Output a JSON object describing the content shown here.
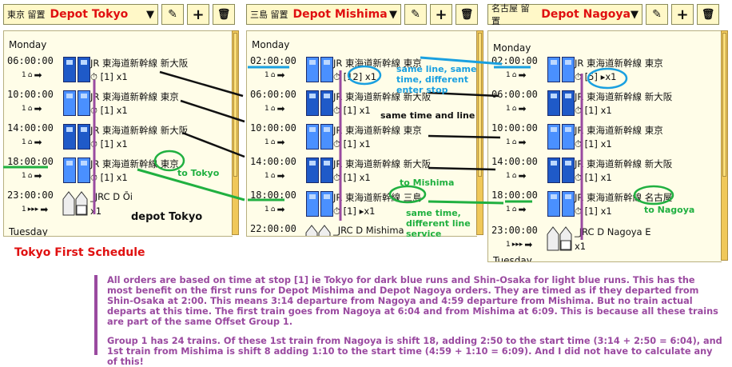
{
  "panels": [
    {
      "prefix": "東京 留置",
      "depot": "Depot Tokyo",
      "day": "Monday",
      "next_day": "Tuesday",
      "rows": [
        {
          "time": "06:00:00",
          "count": "1",
          "line": "JR 東海道新幹線 新大阪",
          "stop": "[1] x1",
          "kind": "dark"
        },
        {
          "time": "10:00:00",
          "count": "1",
          "line": "JR 東海道新幹線 東京",
          "stop": "[1] x1",
          "kind": "light"
        },
        {
          "time": "14:00:00",
          "count": "1",
          "line": "JR 東海道新幹線 新大阪",
          "stop": "[1] x1",
          "kind": "dark"
        },
        {
          "time": "18:00:00",
          "count": "1",
          "line": "JR 東海道新幹線 東京",
          "stop": "[1] x1",
          "kind": "light"
        },
        {
          "time": "23:00:00",
          "count": "1",
          "line": "_JRC D Ōi",
          "stop": "x1",
          "kind": "depot"
        }
      ]
    },
    {
      "prefix": "三島 留置",
      "depot": "Depot Mishima",
      "day": "Monday",
      "rows": [
        {
          "time": "02:00:00",
          "count": "1",
          "line": "JR 東海道新幹線 東京",
          "stop": "[12] x1",
          "kind": "light"
        },
        {
          "time": "06:00:00",
          "count": "1",
          "line": "JR 東海道新幹線 新大阪",
          "stop": "[1] x1",
          "kind": "dark"
        },
        {
          "time": "10:00:00",
          "count": "1",
          "line": "JR 東海道新幹線 東京",
          "stop": "[1] x1",
          "kind": "light"
        },
        {
          "time": "14:00:00",
          "count": "1",
          "line": "JR 東海道新幹線 新大阪",
          "stop": "[1] x1",
          "kind": "dark"
        },
        {
          "time": "18:00:00",
          "count": "1",
          "line": "JR 東海道新幹線 三島",
          "stop": "[1] ▸x1",
          "kind": "light"
        },
        {
          "time": "22:00:00",
          "count": "1",
          "line": "_JRC D Mishima",
          "stop": "x1",
          "kind": "depot"
        }
      ]
    },
    {
      "prefix": "名古屋 留置",
      "depot": "Depot Nagoya",
      "day": "Monday",
      "next_day": "Tuesday",
      "rows": [
        {
          "time": "02:00:00",
          "count": "1",
          "line": "JR 東海道新幹線 東京",
          "stop": "[5] ▸x1",
          "kind": "light"
        },
        {
          "time": "06:00:00",
          "count": "1",
          "line": "JR 東海道新幹線 新大阪",
          "stop": "[1] x1",
          "kind": "dark"
        },
        {
          "time": "10:00:00",
          "count": "1",
          "line": "JR 東海道新幹線 東京",
          "stop": "[1] x1",
          "kind": "light"
        },
        {
          "time": "14:00:00",
          "count": "1",
          "line": "JR 東海道新幹線 新大阪",
          "stop": "[1] x1",
          "kind": "dark"
        },
        {
          "time": "18:00:00",
          "count": "1",
          "line": "JR 東海道新幹線 名古屋",
          "stop": "[1] x1",
          "kind": "light"
        },
        {
          "time": "23:00:00",
          "count": "1",
          "line": "_JRC D Nagoya E",
          "stop": "x1",
          "kind": "depot"
        }
      ]
    }
  ],
  "buttons": {
    "edit": "✎",
    "add": "+",
    "delete": "🗑"
  },
  "annotations": {
    "to_tokyo": "to Tokyo",
    "depot_tokyo": "depot Tokyo",
    "same_line_note": "same line, same time, different enter stop",
    "same_time_line": "same time and line",
    "to_mishima": "to Mishima",
    "same_time_diff": "same time, different line service",
    "to_nagoya": "to Nagoya"
  },
  "title": "Tokyo First Schedule",
  "paragraph1": "All orders are based on time at stop [1] ie Tokyo for dark blue runs and Shin-Osaka for light blue runs. This has the most benefit on the first runs for Depot Mishima and Depot Nagoya orders. They are timed as if they departed from Shin-Osaka at 2:00. This means 3:14 departure from Nagoya and 4:59 departure from Mishima. But no train actual departs at this time. The first train goes from Nagoya at 6:04 and from Mishima at 6:09. This is because all these trains are part of the same Offset Group 1.",
  "paragraph2": "Group 1 has 24 trains. Of these 1st train from Nagoya is shift 18, adding 2:50 to the start time (3:14 + 2:50 = 6:04), and 1st train from Mishima is shift 8 adding 1:10 to the start time (4:59 + 1:10 = 6:09). And I did not have to calculate any of this!",
  "colors": {
    "depot_red": "#e01010",
    "dark_blue": "#1f5ac8",
    "light_blue": "#4a90ff",
    "annot_blue": "#1aa0e0",
    "annot_green": "#20b040",
    "purple": "#9a4aa0"
  }
}
